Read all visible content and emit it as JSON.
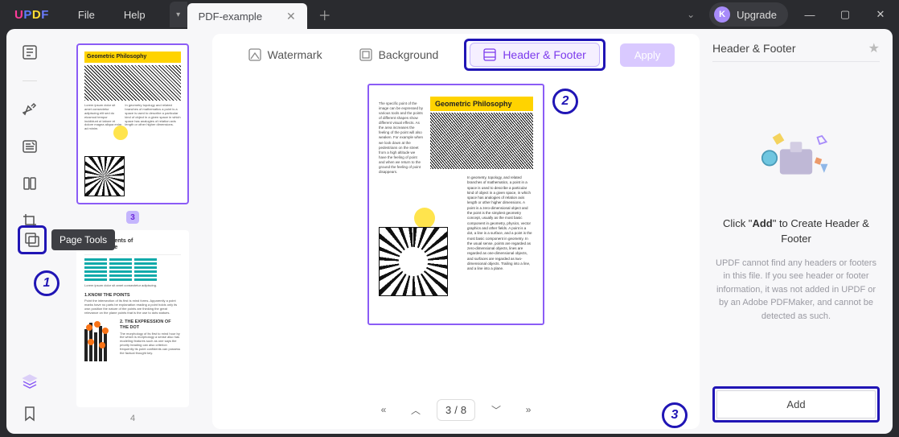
{
  "titlebar": {
    "menu_file": "File",
    "menu_help": "Help",
    "tab_title": "PDF-example",
    "upgrade_label": "Upgrade",
    "avatar_letter": "K"
  },
  "pagetools_tooltip": "Page Tools",
  "thumbs": {
    "page_badge": "3",
    "page_num_2": "4",
    "gp_title": "Geometric Philosophy",
    "be_title_1": "Basic Elements of",
    "be_title_2": "Plane Space",
    "be_h1": "1.KNOW THE POINTS",
    "be_h2": "2. THE EXPRESSION OF THE DOT"
  },
  "top_tabs": {
    "watermark": "Watermark",
    "background": "Background",
    "header_footer": "Header & Footer",
    "apply": "Apply"
  },
  "preview": {
    "banner": "Geometric Philosophy"
  },
  "pager": {
    "current": "3",
    "sep": "/",
    "total": "8"
  },
  "right": {
    "title": "Header & Footer",
    "cta_pre": "Click \"",
    "cta_bold": "Add",
    "cta_post": "\" to Create Header & Footer",
    "desc": "UPDF cannot find any headers or footers in this file. If you see header or footer information, it was not added in UPDF or by an Adobe PDFMaker, and cannot be detected as such.",
    "add_btn": "Add"
  },
  "annotations": {
    "a1": "1",
    "a2": "2",
    "a3": "3"
  }
}
